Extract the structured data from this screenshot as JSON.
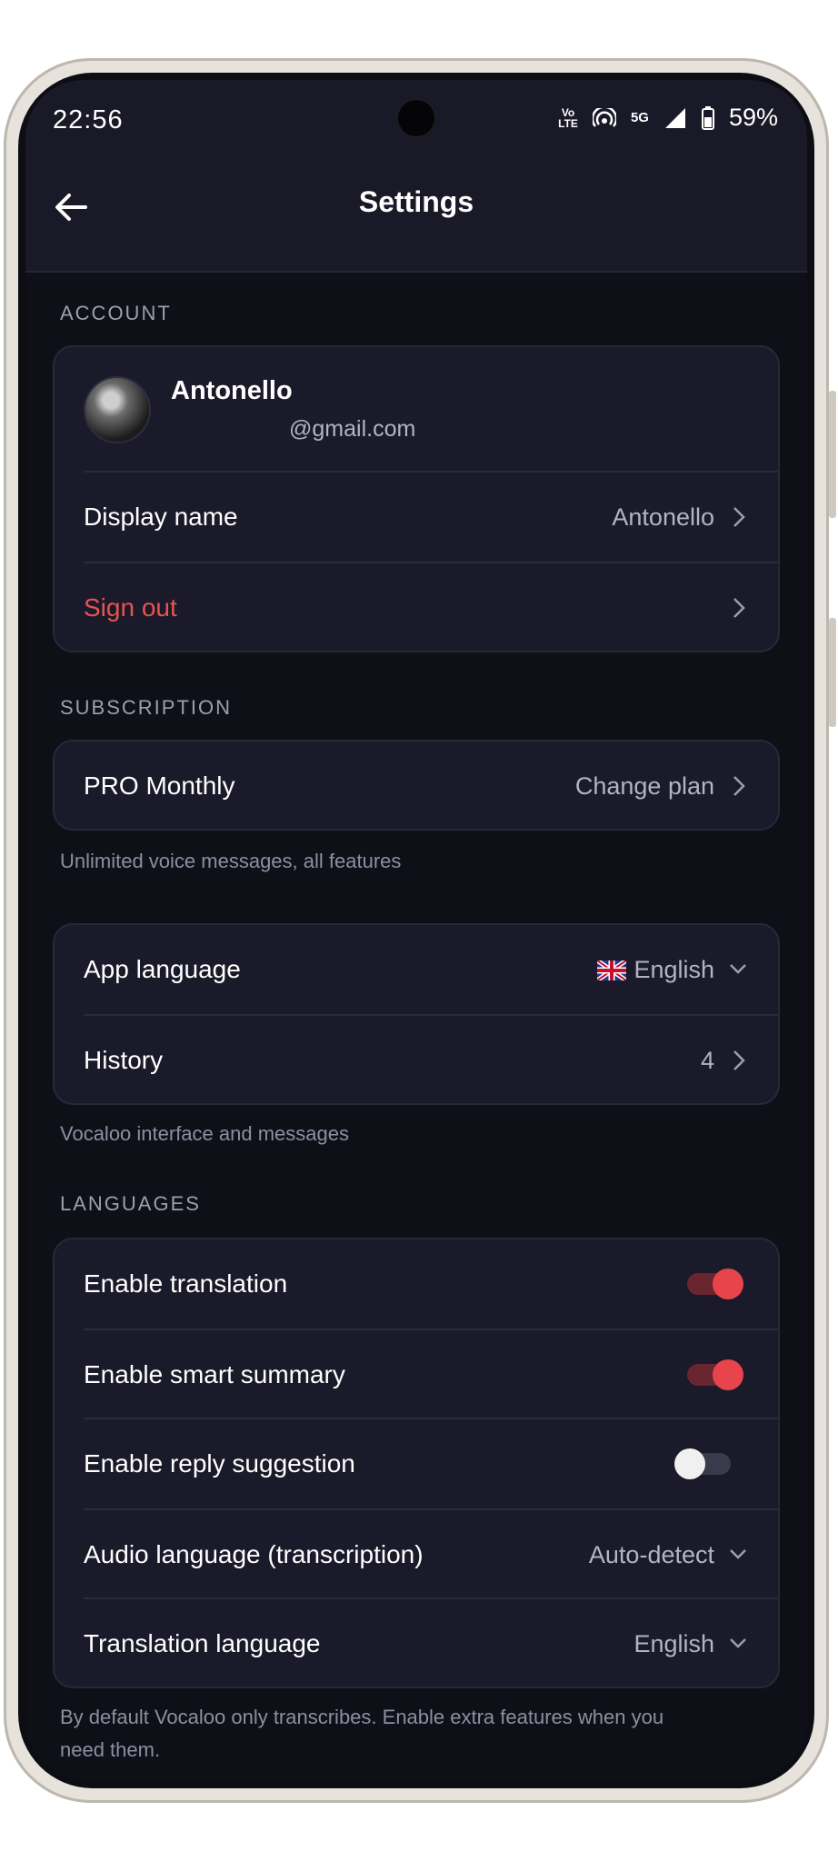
{
  "status_bar": {
    "time": "22:56",
    "volte": "Vo LTE",
    "network": "5G",
    "battery": "59%"
  },
  "header": {
    "title": "Settings",
    "back_icon": "arrow-left-icon"
  },
  "account": {
    "section_label": "ACCOUNT",
    "name": "Antonello",
    "email": "@gmail.com",
    "rows": [
      {
        "label": "Display name",
        "value": "Antonello"
      },
      {
        "label": "Sign out",
        "value": ""
      }
    ]
  },
  "subscription": {
    "section_label": "SUBSCRIPTION",
    "plan": "PRO Monthly",
    "action": "Change plan",
    "note": "Unlimited voice messages, all features"
  },
  "general": {
    "rows": [
      {
        "label": "App language",
        "value": "English",
        "flag": "uk-flag"
      },
      {
        "label": "History",
        "value": "4"
      }
    ],
    "note": "Vocaloo interface and messages"
  },
  "languages": {
    "section_label": "LANGUAGES",
    "toggles": [
      {
        "label": "Enable translation",
        "on": true
      },
      {
        "label": "Enable smart summary",
        "on": true
      },
      {
        "label": "Enable reply suggestion",
        "on": false
      }
    ],
    "selects": [
      {
        "label": "Audio language (transcription)",
        "value": "Auto-detect"
      },
      {
        "label": "Translation language",
        "value": "English"
      }
    ],
    "note_line1": "By default Vocaloo only transcribes. Enable extra features when you",
    "note_line2": "need them."
  },
  "colors": {
    "accent": "#e7454b",
    "background": "#0f0f18",
    "card": "#1a1a2a",
    "danger_text": "#e8534f"
  }
}
